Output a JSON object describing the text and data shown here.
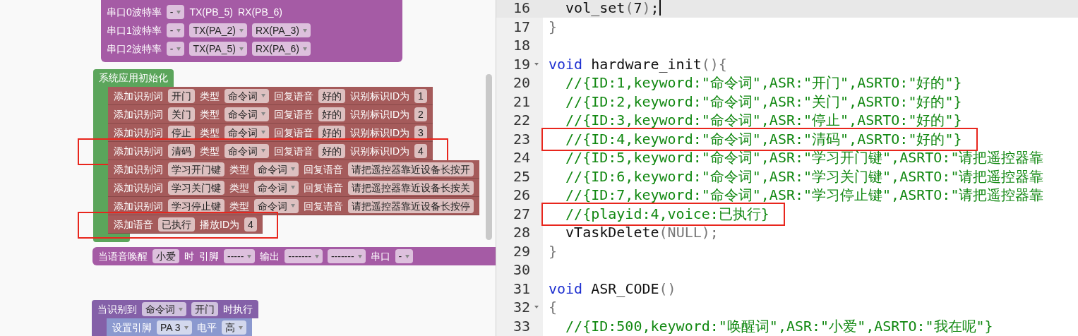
{
  "workspace": {
    "blocks": [
      {
        "kind": "setup",
        "rows": [
          {
            "fields": [
              {
                "kind": "label",
                "text": "串口0波特率"
              },
              {
                "kind": "dropdown",
                "text": "-"
              },
              {
                "kind": "label",
                "text": "TX(PB_5)"
              },
              {
                "kind": "label",
                "text": "RX(PB_6)"
              }
            ]
          },
          {
            "fields": [
              {
                "kind": "label",
                "text": "串口1波特率"
              },
              {
                "kind": "dropdown",
                "text": "-"
              },
              {
                "kind": "dropdown",
                "text": "TX(PA_2)"
              },
              {
                "kind": "dropdown",
                "text": "RX(PA_3)"
              }
            ]
          },
          {
            "fields": [
              {
                "kind": "label",
                "text": "串口2波特率"
              },
              {
                "kind": "dropdown",
                "text": "-"
              },
              {
                "kind": "dropdown",
                "text": "TX(PA_5)"
              },
              {
                "kind": "dropdown",
                "text": "RX(PA_6)"
              }
            ]
          }
        ]
      },
      {
        "kind": "init",
        "header": "系统应用初始化",
        "rows": [
          {
            "highlighted": false,
            "fields": [
              {
                "kind": "label",
                "text": "添加识别词"
              },
              {
                "kind": "input",
                "text": "开门"
              },
              {
                "kind": "label",
                "text": "类型"
              },
              {
                "kind": "dropdown",
                "text": "命令词"
              },
              {
                "kind": "label",
                "text": "回复语音"
              },
              {
                "kind": "input",
                "text": "好的"
              },
              {
                "kind": "label",
                "text": "识别标识ID为"
              },
              {
                "kind": "input",
                "text": "1"
              }
            ]
          },
          {
            "highlighted": false,
            "fields": [
              {
                "kind": "label",
                "text": "添加识别词"
              },
              {
                "kind": "input",
                "text": "关门"
              },
              {
                "kind": "label",
                "text": "类型"
              },
              {
                "kind": "dropdown",
                "text": "命令词"
              },
              {
                "kind": "label",
                "text": "回复语音"
              },
              {
                "kind": "input",
                "text": "好的"
              },
              {
                "kind": "label",
                "text": "识别标识ID为"
              },
              {
                "kind": "input",
                "text": "2"
              }
            ]
          },
          {
            "highlighted": false,
            "fields": [
              {
                "kind": "label",
                "text": "添加识别词"
              },
              {
                "kind": "input",
                "text": "停止"
              },
              {
                "kind": "label",
                "text": "类型"
              },
              {
                "kind": "dropdown",
                "text": "命令词"
              },
              {
                "kind": "label",
                "text": "回复语音"
              },
              {
                "kind": "input",
                "text": "好的"
              },
              {
                "kind": "label",
                "text": "识别标识ID为"
              },
              {
                "kind": "input",
                "text": "3"
              }
            ]
          },
          {
            "highlighted": true,
            "fields": [
              {
                "kind": "label",
                "text": "添加识别词"
              },
              {
                "kind": "input",
                "text": "清码"
              },
              {
                "kind": "label",
                "text": "类型"
              },
              {
                "kind": "dropdown",
                "text": "命令词"
              },
              {
                "kind": "label",
                "text": "回复语音"
              },
              {
                "kind": "input",
                "text": "好的"
              },
              {
                "kind": "label",
                "text": "识别标识ID为"
              },
              {
                "kind": "input",
                "text": "4"
              }
            ]
          },
          {
            "highlighted": false,
            "fields": [
              {
                "kind": "label",
                "text": "添加识别词"
              },
              {
                "kind": "input",
                "text": "学习开门键"
              },
              {
                "kind": "label",
                "text": "类型"
              },
              {
                "kind": "dropdown",
                "text": "命令词"
              },
              {
                "kind": "label",
                "text": "回复语音"
              },
              {
                "kind": "input",
                "text": "请把遥控器靠近设备长按开"
              }
            ]
          },
          {
            "highlighted": false,
            "fields": [
              {
                "kind": "label",
                "text": "添加识别词"
              },
              {
                "kind": "input",
                "text": "学习关门键"
              },
              {
                "kind": "label",
                "text": "类型"
              },
              {
                "kind": "dropdown",
                "text": "命令词"
              },
              {
                "kind": "label",
                "text": "回复语音"
              },
              {
                "kind": "input",
                "text": "请把遥控器靠近设备长按关"
              }
            ]
          },
          {
            "highlighted": false,
            "fields": [
              {
                "kind": "label",
                "text": "添加识别词"
              },
              {
                "kind": "input",
                "text": "学习停止键"
              },
              {
                "kind": "label",
                "text": "类型"
              },
              {
                "kind": "dropdown",
                "text": "命令词"
              },
              {
                "kind": "label",
                "text": "回复语音"
              },
              {
                "kind": "input",
                "text": "请把遥控器靠近设备长按停"
              }
            ]
          },
          {
            "highlighted": true,
            "fields": [
              {
                "kind": "label",
                "text": "添加语音"
              },
              {
                "kind": "input",
                "text": "已执行"
              },
              {
                "kind": "label",
                "text": "播放ID为"
              },
              {
                "kind": "input",
                "text": "4"
              }
            ]
          }
        ]
      },
      {
        "kind": "event",
        "rows": [
          {
            "fields": [
              {
                "kind": "label",
                "text": "当语音唤醒"
              },
              {
                "kind": "input",
                "text": "小爱"
              },
              {
                "kind": "label",
                "text": "时"
              },
              {
                "kind": "label",
                "text": "引脚"
              },
              {
                "kind": "dropdown",
                "text": "-----"
              },
              {
                "kind": "label",
                "text": "输出"
              },
              {
                "kind": "dropdown",
                "text": "-------"
              },
              {
                "kind": "dropdown",
                "text": "-------"
              },
              {
                "kind": "label",
                "text": "串口"
              },
              {
                "kind": "dropdown",
                "text": "-"
              }
            ]
          }
        ]
      },
      {
        "kind": "trigger",
        "rows": [
          {
            "fields": [
              {
                "kind": "label",
                "text": "当识别到"
              },
              {
                "kind": "dropdown",
                "text": "命令词"
              },
              {
                "kind": "input",
                "text": "开门"
              },
              {
                "kind": "label",
                "text": "时执行"
              }
            ]
          }
        ],
        "body": [
          {
            "fields": [
              {
                "kind": "label",
                "text": "设置引脚"
              },
              {
                "kind": "dropdown",
                "text": "PA 3"
              },
              {
                "kind": "label",
                "text": "电平"
              },
              {
                "kind": "dropdown",
                "text": "高"
              }
            ]
          }
        ]
      }
    ]
  },
  "editor": {
    "lines": [
      {
        "number": "16",
        "active": true,
        "cursor": true,
        "segments": [
          {
            "kind": "plain",
            "text": "  vol_set"
          },
          {
            "kind": "punct",
            "text": "("
          },
          {
            "kind": "plain",
            "text": "7"
          },
          {
            "kind": "punct",
            "text": ")"
          },
          {
            "kind": "plain",
            "text": ";"
          }
        ]
      },
      {
        "number": "17",
        "segments": [
          {
            "kind": "punct",
            "text": "}"
          }
        ]
      },
      {
        "number": "18"
      },
      {
        "number": "19",
        "foldable": true,
        "segments": [
          {
            "kind": "keyword",
            "text": "void"
          },
          {
            "kind": "plain",
            "text": " hardware_init"
          },
          {
            "kind": "punct",
            "text": "(){"
          }
        ]
      },
      {
        "number": "20",
        "segments": [
          {
            "kind": "comment",
            "text": "  //{ID:1,keyword:\"命令词\",ASR:\"开门\",ASRTO:\"好的\"}"
          }
        ]
      },
      {
        "number": "21",
        "segments": [
          {
            "kind": "comment",
            "text": "  //{ID:2,keyword:\"命令词\",ASR:\"关门\",ASRTO:\"好的\"}"
          }
        ]
      },
      {
        "number": "22",
        "segments": [
          {
            "kind": "comment",
            "text": "  //{ID:3,keyword:\"命令词\",ASR:\"停止\",ASRTO:\"好的\"}"
          }
        ]
      },
      {
        "number": "23",
        "highlighted": true,
        "segments": [
          {
            "kind": "comment",
            "text": "  //{ID:4,keyword:\"命令词\",ASR:\"清码\",ASRTO:\"好的\"}"
          }
        ]
      },
      {
        "number": "24",
        "segments": [
          {
            "kind": "comment",
            "text": "  //{ID:5,keyword:\"命令词\",ASR:\"学习开门键\",ASRTO:\"请把遥控器靠"
          }
        ]
      },
      {
        "number": "25",
        "segments": [
          {
            "kind": "comment",
            "text": "  //{ID:6,keyword:\"命令词\",ASR:\"学习关门键\",ASRTO:\"请把遥控器靠"
          }
        ]
      },
      {
        "number": "26",
        "segments": [
          {
            "kind": "comment",
            "text": "  //{ID:7,keyword:\"命令词\",ASR:\"学习停止键\",ASRTO:\"请把遥控器靠"
          }
        ]
      },
      {
        "number": "27",
        "highlighted": true,
        "segments": [
          {
            "kind": "comment",
            "text": "  //{playid:4,voice:已执行}"
          }
        ]
      },
      {
        "number": "28",
        "segments": [
          {
            "kind": "plain",
            "text": "  vTaskDelete"
          },
          {
            "kind": "punct",
            "text": "(NULL);"
          }
        ]
      },
      {
        "number": "29",
        "segments": [
          {
            "kind": "punct",
            "text": "}"
          }
        ]
      },
      {
        "number": "30"
      },
      {
        "number": "31",
        "segments": [
          {
            "kind": "keyword",
            "text": "void"
          },
          {
            "kind": "plain",
            "text": " ASR_CODE"
          },
          {
            "kind": "punct",
            "text": "()"
          }
        ]
      },
      {
        "number": "32",
        "foldable": true,
        "segments": [
          {
            "kind": "punct",
            "text": "{"
          }
        ]
      },
      {
        "number": "33",
        "segments": [
          {
            "kind": "comment",
            "text": "  //{ID:500,keyword:\"唤醒词\",ASR:\"小爱\",ASRTO:\"我在呢\"}"
          }
        ]
      }
    ]
  }
}
